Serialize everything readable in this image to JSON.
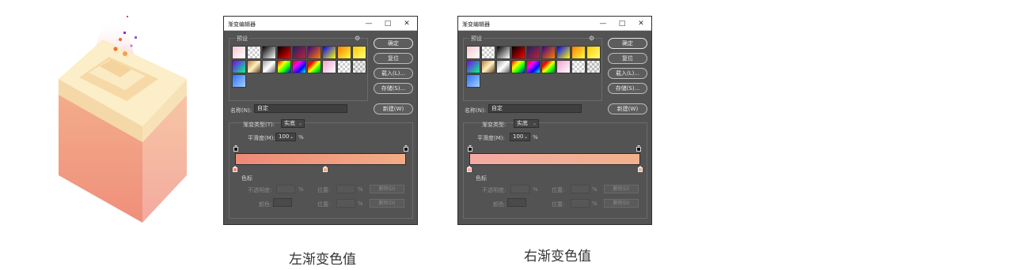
{
  "colors": {
    "panel_bg": "#535353",
    "stop_left": "#f08c78",
    "stop_right": "#f4b48c"
  },
  "dialogs": [
    {
      "title": "渐变编辑器",
      "presets_label": "预设",
      "settings_icon": "gear-icon",
      "buttons": {
        "ok": "确定",
        "reset": "复位",
        "load": "载入(L)...",
        "save": "存储(S)..."
      },
      "name_label": "名称(N):",
      "name_value": "自定",
      "new_button": "新建(W)",
      "type_label": "渐变类型(T):",
      "type_value": "实底",
      "smooth_label": "平滑度(M):",
      "smooth_value": "100",
      "smooth_unit": "%",
      "stops_label": "色标",
      "opacity_label": "不透明度:",
      "location_label": "位置:",
      "color_label": "颜色:",
      "delete_label": "删除(D)",
      "percent": "%",
      "gradient": {
        "start": "#ee8a78",
        "end": "#f3ac86"
      },
      "color_stop_positions": [
        0,
        0.53
      ]
    },
    {
      "title": "渐变编辑器",
      "presets_label": "预设",
      "settings_icon": "gear-icon",
      "buttons": {
        "ok": "确定",
        "reset": "复位",
        "load": "载入(L)...",
        "save": "存储(S)..."
      },
      "name_label": "名称(N):",
      "name_value": "自定",
      "new_button": "新建(W)",
      "type_label": "渐变类型:",
      "type_value": "实底",
      "smooth_label": "平滑度(M):",
      "smooth_value": "100",
      "smooth_unit": "%",
      "stops_label": "色标",
      "opacity_label": "不透明度:",
      "location_label": "位置:",
      "color_label": "颜色:",
      "delete_label": "删除(D)",
      "percent": "%",
      "gradient": {
        "start": "#f3aaa3",
        "end": "#f2b18d"
      },
      "color_stop_positions": [
        0,
        1
      ]
    }
  ],
  "presets": [
    "linear-gradient(135deg,#f8c8d0,#ffffff)",
    "repeating-conic-gradient(#ccc 0 25%,#fff 0 50%) 0 0/6px 6px",
    "linear-gradient(135deg,#000,#fff)",
    "linear-gradient(135deg,#000,#ff0000)",
    "linear-gradient(135deg,#202060,#c02040)",
    "linear-gradient(135deg,#400080,#ff8000)",
    "linear-gradient(135deg,#0000ff,#ffff00)",
    "linear-gradient(135deg,#ff8000,#ffff40)",
    "linear-gradient(135deg,#ffcc00,#ffff80)",
    "linear-gradient(135deg,#8000ff,#00ff80)",
    "linear-gradient(135deg,#c08040,#fff0c0,#604020)",
    "linear-gradient(135deg,#a0a0a0,#fff,#606060)",
    "linear-gradient(135deg,#ff0000,#ffff00,#00ff00,#0000ff)",
    "linear-gradient(135deg,#ff0000,#ff00ff,#0000ff,#00ffff)",
    "linear-gradient(135deg,transparent,#ff0000,#ffff00,#00ff00,transparent)",
    "linear-gradient(135deg,#f0a0d0,#fff)",
    "repeating-conic-gradient(#ccc 0 25%,#fff 0 50%) 0 0/6px 6px",
    "repeating-conic-gradient(#bbb 0 25%,#eee 0 50%) 0 0/6px 6px",
    "linear-gradient(135deg,#3070ff,#a0d0ff)"
  ],
  "captions": [
    "左渐变色值",
    "右渐变色值"
  ]
}
